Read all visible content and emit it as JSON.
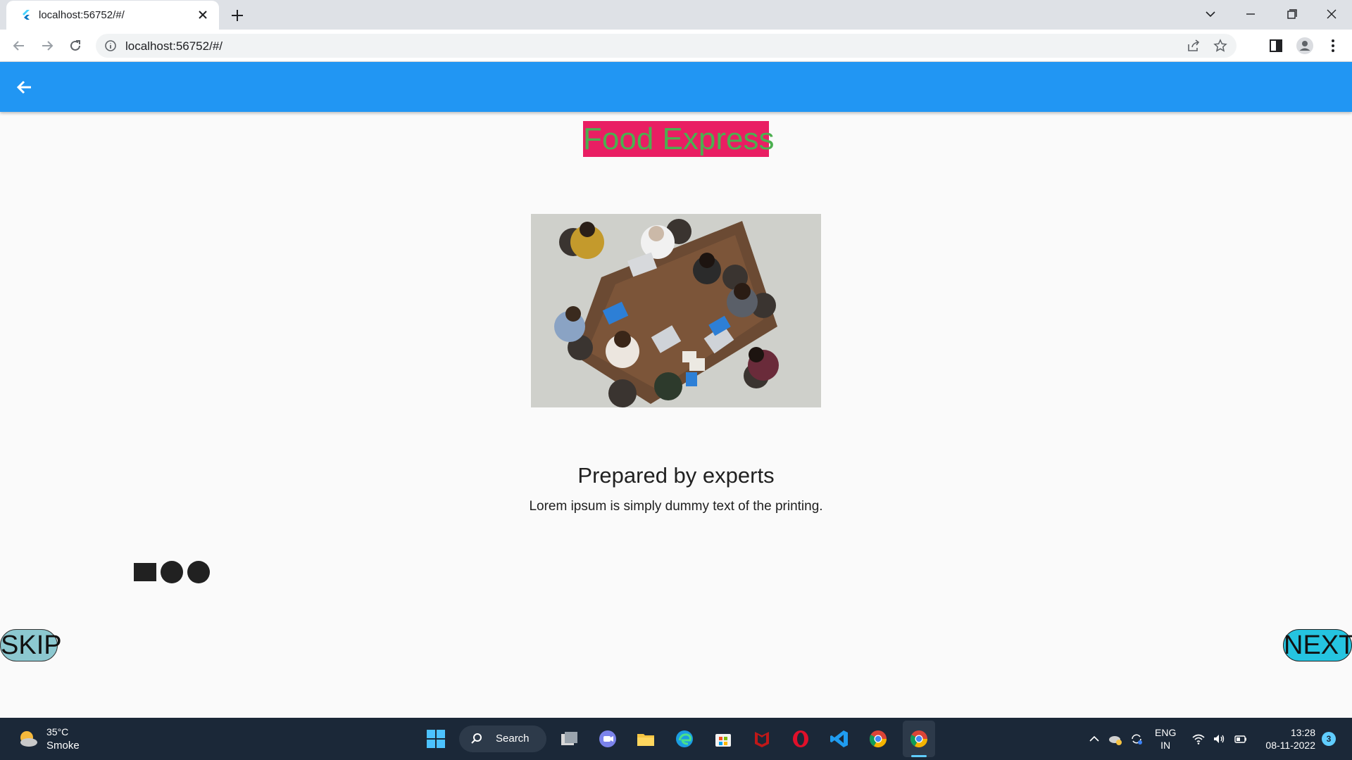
{
  "browser": {
    "tab_title": "localhost:56752/#/",
    "url": "localhost:56752/#/"
  },
  "app": {
    "title": "Food Express",
    "appbar_color": "#2196f3",
    "title_bg_color": "#e91e63",
    "title_text_color": "#4caf50"
  },
  "slide": {
    "heading": "Prepared by experts",
    "subtitle": "Lorem ipsum is simply dummy text of the printing.",
    "page_count": 3,
    "current_page": 1
  },
  "buttons": {
    "skip_label": "SKIP",
    "next_label": "NEXT"
  },
  "taskbar": {
    "weather_temp": "35°C",
    "weather_desc": "Smoke",
    "search_label": "Search",
    "lang_line1": "ENG",
    "lang_line2": "IN",
    "time": "13:28",
    "date": "08-11-2022",
    "notification_count": "3"
  }
}
